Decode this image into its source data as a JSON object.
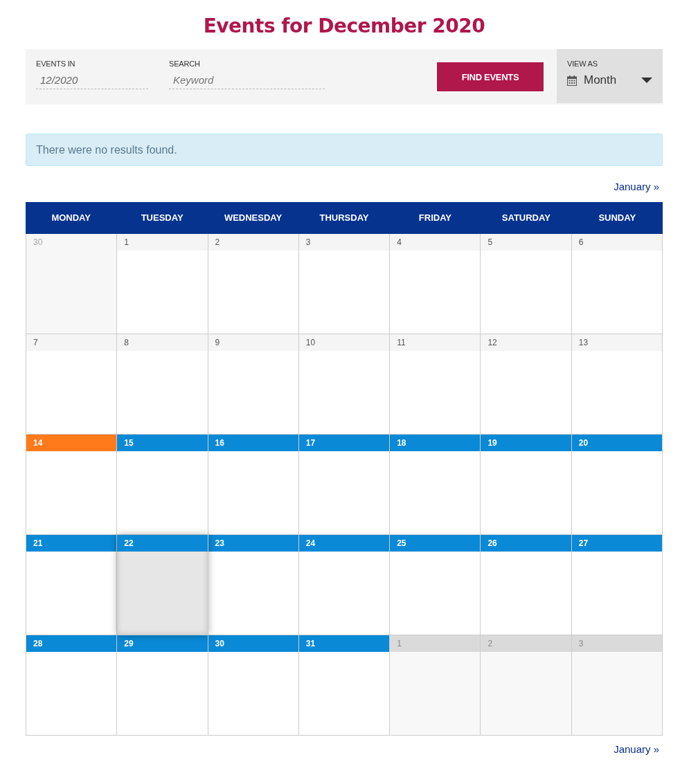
{
  "title": "Events for December 2020",
  "filter_bar": {
    "events_in": {
      "label": "EVENTS IN",
      "value": "12/2020"
    },
    "search": {
      "label": "SEARCH",
      "placeholder": "Keyword"
    },
    "find_button": "FIND EVENTS",
    "view_as": {
      "label": "VIEW AS",
      "value": "Month"
    }
  },
  "notice": "There were no results found.",
  "nav_top": "January »",
  "calendar": {
    "columns": [
      "MONDAY",
      "TUESDAY",
      "WEDNESDAY",
      "THURSDAY",
      "FRIDAY",
      "SATURDAY",
      "SUNDAY"
    ],
    "weeks": [
      {
        "days": [
          {
            "day": "30",
            "kind": "prev_month",
            "hovered": false
          },
          {
            "day": "1",
            "kind": "past",
            "hovered": false
          },
          {
            "day": "2",
            "kind": "past",
            "hovered": false
          },
          {
            "day": "3",
            "kind": "past",
            "hovered": false
          },
          {
            "day": "4",
            "kind": "past",
            "hovered": false
          },
          {
            "day": "5",
            "kind": "past",
            "hovered": false
          },
          {
            "day": "6",
            "kind": "past",
            "hovered": false
          }
        ]
      },
      {
        "days": [
          {
            "day": "7",
            "kind": "past",
            "hovered": false
          },
          {
            "day": "8",
            "kind": "past",
            "hovered": false
          },
          {
            "day": "9",
            "kind": "past",
            "hovered": false
          },
          {
            "day": "10",
            "kind": "past",
            "hovered": false
          },
          {
            "day": "11",
            "kind": "past",
            "hovered": false
          },
          {
            "day": "12",
            "kind": "past",
            "hovered": false
          },
          {
            "day": "13",
            "kind": "past",
            "hovered": false
          }
        ]
      },
      {
        "days": [
          {
            "day": "14",
            "kind": "today",
            "hovered": false
          },
          {
            "day": "15",
            "kind": "future",
            "hovered": false
          },
          {
            "day": "16",
            "kind": "future",
            "hovered": false
          },
          {
            "day": "17",
            "kind": "future",
            "hovered": false
          },
          {
            "day": "18",
            "kind": "future",
            "hovered": false
          },
          {
            "day": "19",
            "kind": "future",
            "hovered": false
          },
          {
            "day": "20",
            "kind": "future",
            "hovered": false
          }
        ]
      },
      {
        "days": [
          {
            "day": "21",
            "kind": "future",
            "hovered": false
          },
          {
            "day": "22",
            "kind": "future",
            "hovered": true
          },
          {
            "day": "23",
            "kind": "future",
            "hovered": false
          },
          {
            "day": "24",
            "kind": "future",
            "hovered": false
          },
          {
            "day": "25",
            "kind": "future",
            "hovered": false
          },
          {
            "day": "26",
            "kind": "future",
            "hovered": false
          },
          {
            "day": "27",
            "kind": "future",
            "hovered": false
          }
        ]
      },
      {
        "days": [
          {
            "day": "28",
            "kind": "future",
            "hovered": false
          },
          {
            "day": "29",
            "kind": "future",
            "hovered": false
          },
          {
            "day": "30",
            "kind": "future",
            "hovered": false
          },
          {
            "day": "31",
            "kind": "future",
            "hovered": false
          },
          {
            "day": "1",
            "kind": "next_month",
            "hovered": false
          },
          {
            "day": "2",
            "kind": "next_month",
            "hovered": false
          },
          {
            "day": "3",
            "kind": "next_month",
            "hovered": false
          }
        ]
      }
    ]
  },
  "nav_bottom": "January »"
}
